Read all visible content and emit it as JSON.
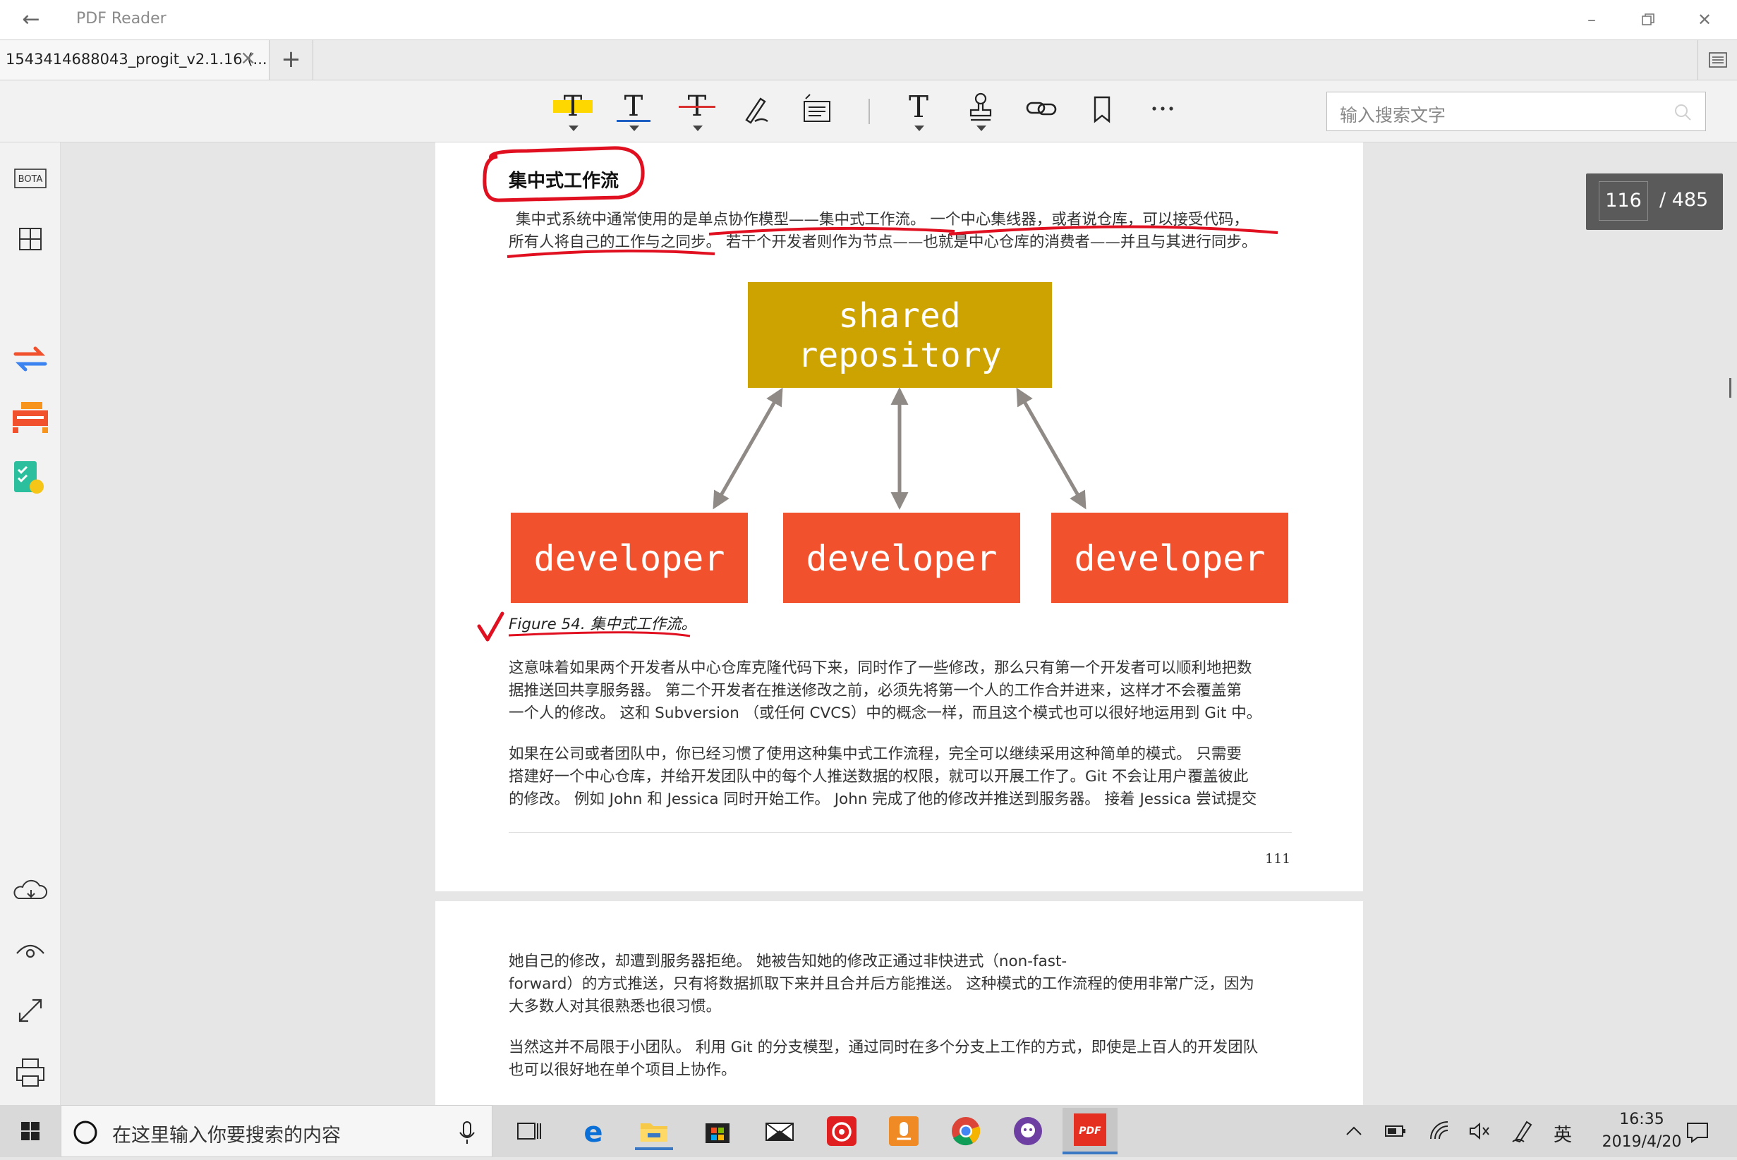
{
  "window": {
    "title": "PDF Reader"
  },
  "tabs": [
    {
      "label": "1543414688043_progit_v2.1.16 (..."
    }
  ],
  "toolbar": {
    "tools": [
      "highlight-tool",
      "underline-tool",
      "strikethrough-tool",
      "pen-tool",
      "note-tool",
      "text-tool",
      "stamp-tool",
      "link-tool",
      "bookmark-tool",
      "more-tool"
    ],
    "search_placeholder": "输入搜索文字",
    "highlight_color": "#ffd700",
    "underline_color": "#1e5fc4",
    "strike_color": "#d93030"
  },
  "sidebar": {
    "bota_label": "BOTA"
  },
  "page_counter": {
    "current": "116",
    "total": "/ 485"
  },
  "document": {
    "heading": "集中式工作流",
    "intro_line1": "集中式系统中通常使用的是单点协作模型——集中式工作流。 一个中心集线器，或者说仓库，可以接受代码，",
    "intro_line2": "所有人将自己的工作与之同步。 若干个开发者则作为节点——也就是中心仓库的消费者——并且与其进行同步。",
    "figure": {
      "repo_line1": "shared",
      "repo_line2": "repository",
      "developer": [
        "developer",
        "developer",
        "developer"
      ],
      "caption": "Figure 54. 集中式工作流。",
      "repo_color": "#cca300",
      "dev_color": "#f2512e"
    },
    "p1": [
      "这意味着如果两个开发者从中心仓库克隆代码下来，同时作了一些修改，那么只有第一个开发者可以顺利地把数",
      "据推送回共享服务器。 第二个开发者在推送修改之前，必须先将第一个人的工作合并进来，这样才不会覆盖第",
      "一个人的修改。 这和 Subversion （或任何 CVCS）中的概念一样，而且这个模式也可以很好地运用到 Git 中。"
    ],
    "p2": [
      "如果在公司或者团队中，你已经习惯了使用这种集中式工作流程，完全可以继续采用这种简单的模式。 只需要",
      "搭建好一个中心仓库，并给开发团队中的每个人推送数据的权限，就可以开展工作了。Git 不会让用户覆盖彼此",
      "的修改。 例如 John 和 Jessica 同时开始工作。 John 完成了他的修改并推送到服务器。 接着 Jessica 尝试提交"
    ],
    "page_number": "111",
    "page2_p1": [
      "她自己的修改，却遭到服务器拒绝。 她被告知她的修改正通过非快进式（non-fast-",
      "forward）的方式推送，只有将数据抓取下来并且合并后方能推送。 这种模式的工作流程的使用非常广泛，因为",
      "大多数人对其很熟悉也很习惯。"
    ],
    "page2_p2": [
      "当然这并不局限于小团队。 利用 Git 的分支模型，通过同时在多个分支上工作的方式，即使是上百人的开发团队",
      "也可以很好地在单个项目上协作。"
    ]
  },
  "taskbar": {
    "search_placeholder": "在这里输入你要搜索的内容",
    "apps": [
      "task-view",
      "edge",
      "file-explorer",
      "store",
      "mail",
      "netease-music",
      "app-orange",
      "chrome",
      "github",
      "pdf-reader"
    ],
    "pdf_label": "PDF",
    "ime": "英",
    "time": "16:35",
    "date": "2019/4/20"
  }
}
